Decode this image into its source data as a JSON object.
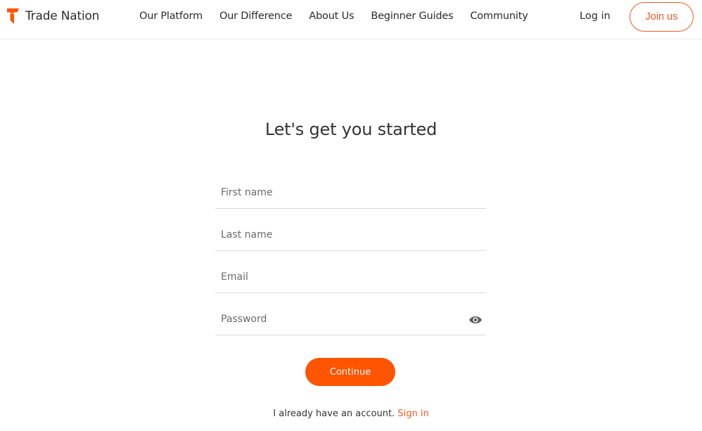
{
  "header": {
    "logo_text": "Trade Nation",
    "logo_icon": "trade-nation-logo-icon",
    "nav": [
      {
        "label": "Our Platform"
      },
      {
        "label": "Our Difference"
      },
      {
        "label": "About Us"
      },
      {
        "label": "Beginner Guides"
      },
      {
        "label": "Community"
      }
    ],
    "login_label": "Log in",
    "join_label": "Join us"
  },
  "form": {
    "title": "Let's get you started",
    "fields": {
      "first_name": {
        "placeholder": "First name",
        "value": ""
      },
      "last_name": {
        "placeholder": "Last name",
        "value": ""
      },
      "email": {
        "placeholder": "Email",
        "value": ""
      },
      "password": {
        "placeholder": "Password",
        "value": ""
      }
    },
    "password_toggle_icon": "eye-icon",
    "continue_label": "Continue",
    "already_text": "I already have an account.",
    "signin_label": "Sign in"
  },
  "colors": {
    "accent": "#ff5400",
    "accent_text": "#f15a22",
    "text": "#2b2b2b",
    "divider": "#d9d9d9"
  }
}
